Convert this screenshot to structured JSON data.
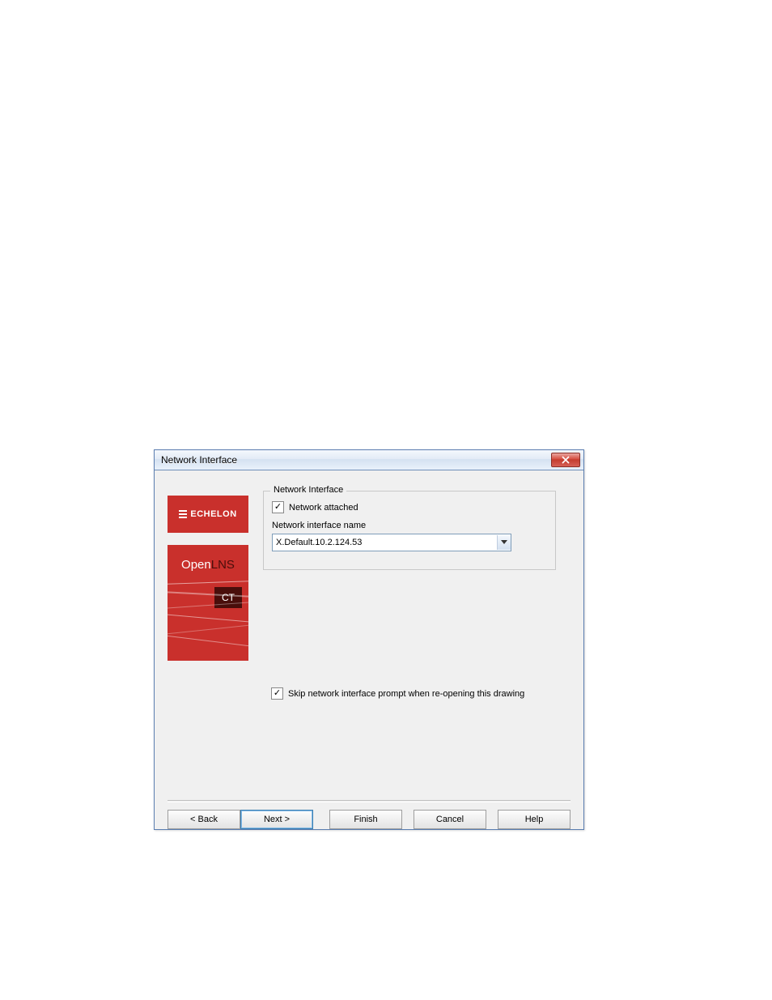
{
  "dialog": {
    "title": "Network Interface"
  },
  "sidebar": {
    "echelon": "ECHELON",
    "open": "Open",
    "lns": "LNS",
    "ct": "CT"
  },
  "fieldset": {
    "legend": "Network Interface",
    "attached_label": "Network attached",
    "attached_checked": true,
    "ifname_label": "Network interface name",
    "ifname_value": "X.Default.10.2.124.53"
  },
  "skip": {
    "label": "Skip network interface prompt when re-opening this drawing",
    "checked": true
  },
  "buttons": {
    "back": "< Back",
    "next": "Next >",
    "finish": "Finish",
    "cancel": "Cancel",
    "help": "Help"
  }
}
